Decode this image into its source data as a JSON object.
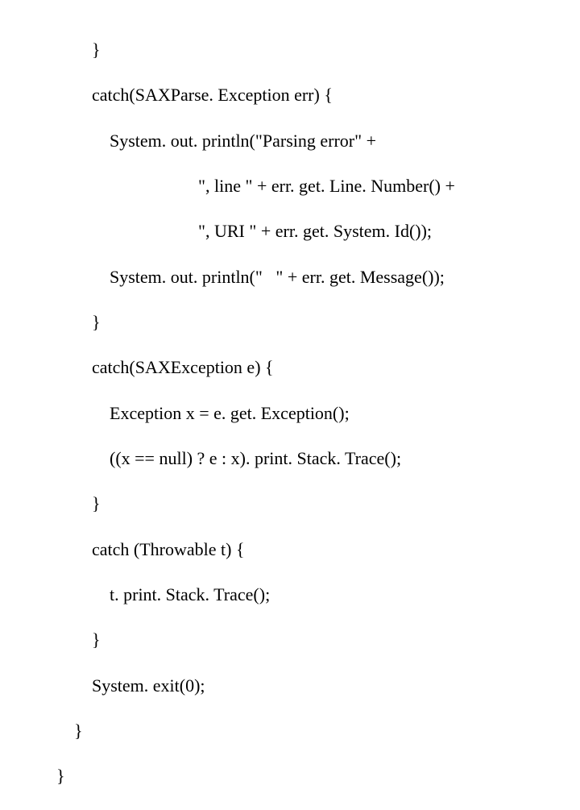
{
  "code": {
    "l1": "        }",
    "l2": "        catch(SAXParse. Exception err) {",
    "l3": "            System. out. println(\"Parsing error\" +",
    "l4": "                                \", line \" + err. get. Line. Number() +",
    "l5": "                                \", URI \" + err. get. System. Id());",
    "l6": "            System. out. println(\"   \" + err. get. Message());",
    "l7": "        }",
    "l8": "        catch(SAXException e) {",
    "l9": "            Exception x = e. get. Exception();",
    "l10": "            ((x == null) ? e : x). print. Stack. Trace();",
    "l11": "        }",
    "l12": "        catch (Throwable t) {",
    "l13": "            t. print. Stack. Trace();",
    "l14": "        }",
    "l15": "        System. exit(0);",
    "l16": "    }",
    "l17": "}"
  }
}
